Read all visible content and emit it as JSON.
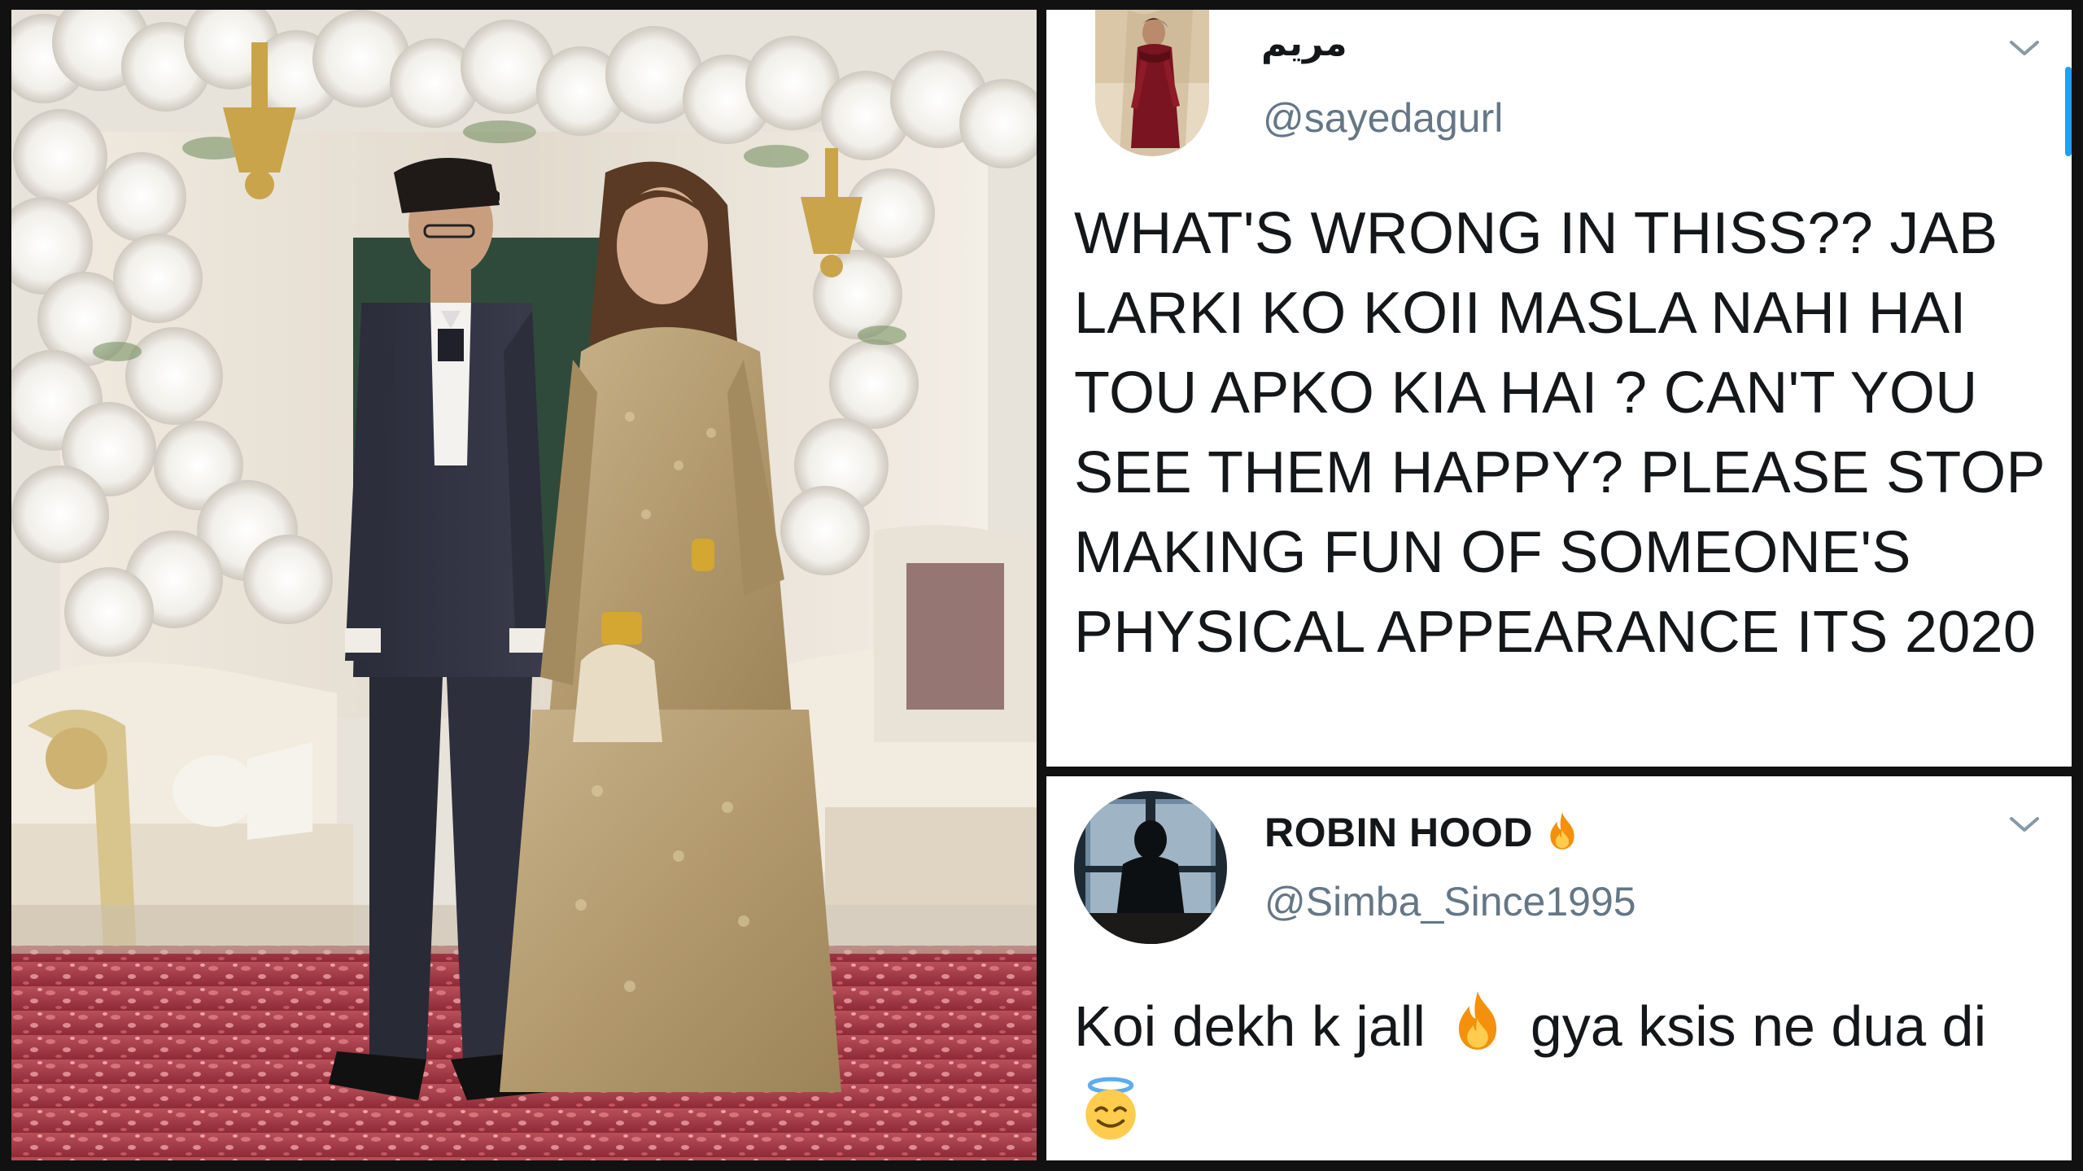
{
  "tweets": [
    {
      "display_name": "مريم",
      "handle": "@sayedagurl",
      "avatar_icon": "profile-photo-woman",
      "menu_icon": "chevron-down-icon",
      "text": "WHAT'S WRONG IN THISS?? JAB LARKI KO KOII MASLA NAHI HAI TOU APKO KIA HAI ? CAN'T YOU SEE THEM HAPPY? PLEASE STOP MAKING FUN OF SOMEONE'S PHYSICAL APPEARANCE ITS 2020"
    },
    {
      "display_name": "ROBIN HOOD",
      "name_emoji": "fire-emoji",
      "handle": "@Simba_Since1995",
      "avatar_icon": "profile-photo-silhouette",
      "menu_icon": "chevron-down-icon",
      "text_part1": "Koi dekh k jall",
      "text_emoji1": "fire-emoji",
      "text_part2": "gya ksis ne dua di",
      "text_emoji2": "smiling-face-with-halo-emoji"
    }
  ],
  "colors": {
    "handle": "#657786",
    "text": "#14171a",
    "accent": "#1da1f2",
    "background": "#0d0d0d"
  }
}
